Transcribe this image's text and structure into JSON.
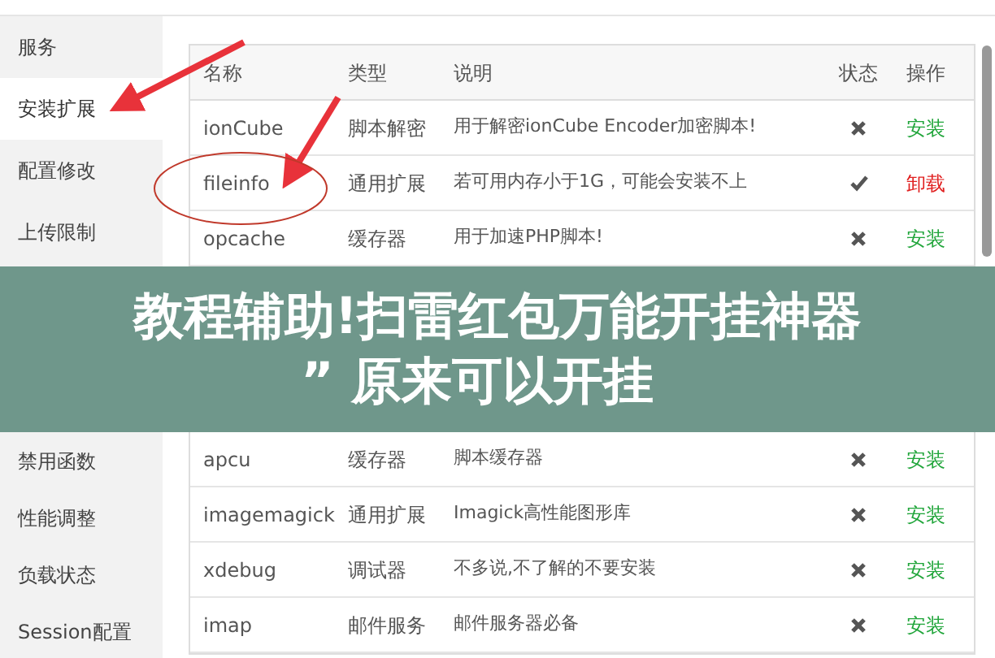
{
  "sidebar": {
    "items": [
      {
        "label": "服务",
        "selected": false
      },
      {
        "label": "安装扩展",
        "selected": true
      },
      {
        "label": "配置修改",
        "selected": false
      },
      {
        "label": "上传限制",
        "selected": false
      },
      {
        "label": "禁用函数",
        "selected": false
      },
      {
        "label": "性能调整",
        "selected": false
      },
      {
        "label": "负载状态",
        "selected": false
      },
      {
        "label": "Session配置",
        "selected": false
      }
    ]
  },
  "table": {
    "columns": [
      "名称",
      "类型",
      "说明",
      "状态",
      "操作"
    ],
    "rows": [
      {
        "name": "ionCube",
        "type": "脚本解密",
        "description": "用于解密ionCube Encoder加密脚本!",
        "installed": false,
        "action": "安装"
      },
      {
        "name": "fileinfo",
        "type": "通用扩展",
        "description": "若可用内存小于1G，可能会安装不上",
        "installed": true,
        "action": "卸载"
      },
      {
        "name": "opcache",
        "type": "缓存器",
        "description": "用于加速PHP脚本!",
        "installed": false,
        "action": "安装"
      },
      {
        "name": "apcu",
        "type": "缓存器",
        "description": "脚本缓存器",
        "installed": false,
        "action": "安装"
      },
      {
        "name": "imagemagick",
        "type": "通用扩展",
        "description": "Imagick高性能图形库",
        "installed": false,
        "action": "安装"
      },
      {
        "name": "xdebug",
        "type": "调试器",
        "description": "不多说,不了解的不要安装",
        "installed": false,
        "action": "安装"
      },
      {
        "name": "imap",
        "type": "邮件服务",
        "description": "邮件服务器必备",
        "installed": false,
        "action": "安装"
      }
    ]
  },
  "banner": {
    "lines": [
      "教程辅助!扫雷红包万能开挂神器",
      "” 原来可以开挂"
    ]
  }
}
